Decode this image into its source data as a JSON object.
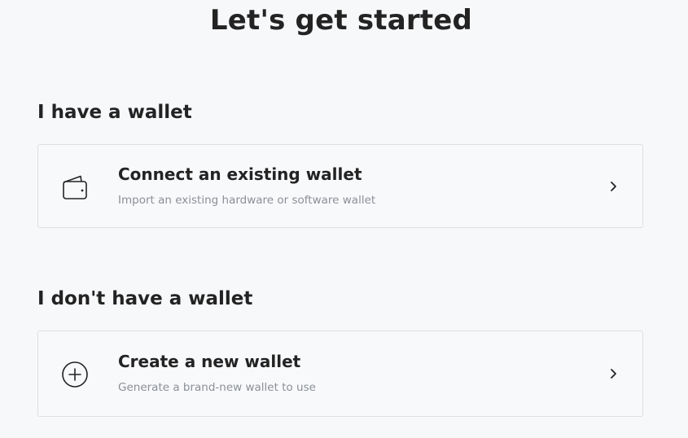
{
  "title": "Let's get started",
  "sections": [
    {
      "heading": "I have a wallet",
      "option": {
        "icon": "wallet-icon",
        "title": "Connect an existing wallet",
        "description": "Import an existing hardware or software wallet"
      }
    },
    {
      "heading": "I don't have a wallet",
      "option": {
        "icon": "plus-circle-icon",
        "title": "Create a new wallet",
        "description": "Generate a brand-new wallet to use"
      }
    }
  ],
  "colors": {
    "background": "#f7f8fa",
    "text": "#232323",
    "muted_text": "#8b8f96",
    "card_border": "#dcdfe4"
  }
}
